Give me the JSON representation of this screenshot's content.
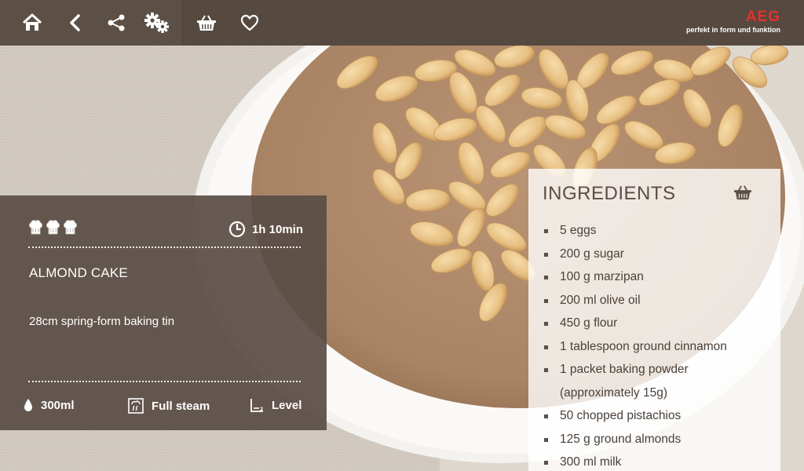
{
  "toolbar": {
    "icons": [
      "home-icon",
      "back-icon",
      "share-icon",
      "settings-icon",
      "basket-icon",
      "heart-icon"
    ]
  },
  "brand": {
    "logo": "AEG",
    "tagline": "perfekt in form und funktion"
  },
  "recipe": {
    "difficulty_level": 3,
    "difficulty_max": 3,
    "time": "1h 10min",
    "title": "ALMOND CAKE",
    "description": "28cm spring-form baking tin",
    "water": "300ml",
    "steam": "Full steam",
    "level": "Level"
  },
  "ingredients": {
    "heading": "INGREDIENTS",
    "items": [
      {
        "line1": "5 eggs"
      },
      {
        "line1": "200 g sugar"
      },
      {
        "line1": "100 g marzipan"
      },
      {
        "line1": "200 ml olive oil"
      },
      {
        "line1": "450 g flour"
      },
      {
        "line1": "1 tablespoon ground cinnamon"
      },
      {
        "line1": "1 packet baking powder",
        "line2": "(approximately 15g)"
      },
      {
        "line1": "50 chopped pistachios"
      },
      {
        "line1": "125 g ground almonds"
      },
      {
        "line1": "300 ml milk"
      }
    ]
  },
  "colors": {
    "toolbar": "#5b4f46",
    "panel": "#5a4e46",
    "brand_red": "#e4322b",
    "cake": "#b08a6a",
    "almond": "#e8c48a",
    "plate": "#f7f5f2",
    "linen": "#c9c2b8"
  }
}
